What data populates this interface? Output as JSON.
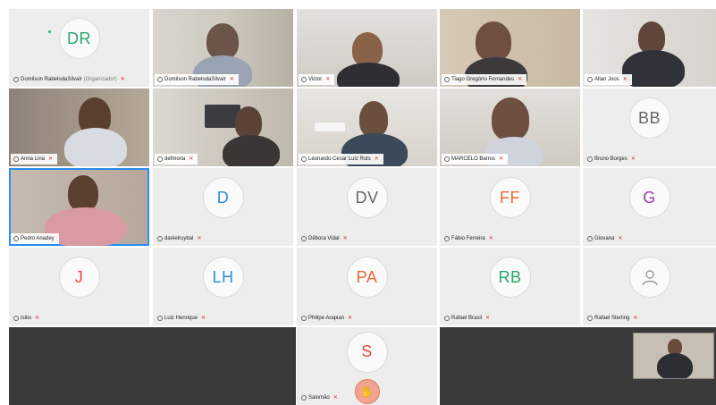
{
  "participants": [
    {
      "name": "Domilson RabelodaSilvalr",
      "role": "(Organizador)",
      "type": "avatar",
      "initials": "DR",
      "color": "#2aa86b"
    },
    {
      "name": "Domilson RabelodaSilvalr",
      "type": "video"
    },
    {
      "name": "Victor",
      "type": "video"
    },
    {
      "name": "Tiago Gregório Fernandes",
      "type": "video"
    },
    {
      "name": "Allan Joos",
      "type": "video"
    },
    {
      "name": "Anna Lina",
      "type": "video"
    },
    {
      "name": "defmoria",
      "type": "video"
    },
    {
      "name": "Leonardo César Luiz Ruts",
      "type": "video"
    },
    {
      "name": "MARCELO Barros",
      "type": "video"
    },
    {
      "name": "Bruno Borges",
      "type": "avatar",
      "initials": "BB",
      "color": "#666666"
    },
    {
      "name": "Pedro Anadey",
      "type": "video",
      "active": true
    },
    {
      "name": "danielruybal",
      "type": "avatar",
      "initials": "D",
      "color": "#2f8fd6"
    },
    {
      "name": "Dêbora Vidal",
      "type": "avatar",
      "initials": "DV",
      "color": "#666666"
    },
    {
      "name": "Fábio Ferreira",
      "type": "avatar",
      "initials": "FF",
      "color": "#e8683a"
    },
    {
      "name": "Giovana",
      "type": "avatar",
      "initials": "G",
      "color": "#9b3fa6"
    },
    {
      "name": "Isilio",
      "type": "avatar",
      "initials": "J",
      "color": "#e04a3a"
    },
    {
      "name": "Luiz Henrique",
      "type": "avatar",
      "initials": "LH",
      "color": "#2f8fd6"
    },
    {
      "name": "Philipe Arapian",
      "type": "avatar",
      "initials": "PA",
      "color": "#e8683a"
    },
    {
      "name": "Rafael Brasil",
      "type": "avatar",
      "initials": "RB",
      "color": "#2aa86b"
    },
    {
      "name": "Rafael Sterling",
      "type": "silhouette"
    },
    {
      "name": "Salomão",
      "type": "avatar",
      "initials": "S",
      "color": "#e04a3a",
      "raise": true
    }
  ],
  "colors": {
    "tile_bg": "#ededed",
    "dark_bg": "#3a3a3a",
    "active_border": "#2d8cff",
    "mute": "#e02b2b"
  }
}
